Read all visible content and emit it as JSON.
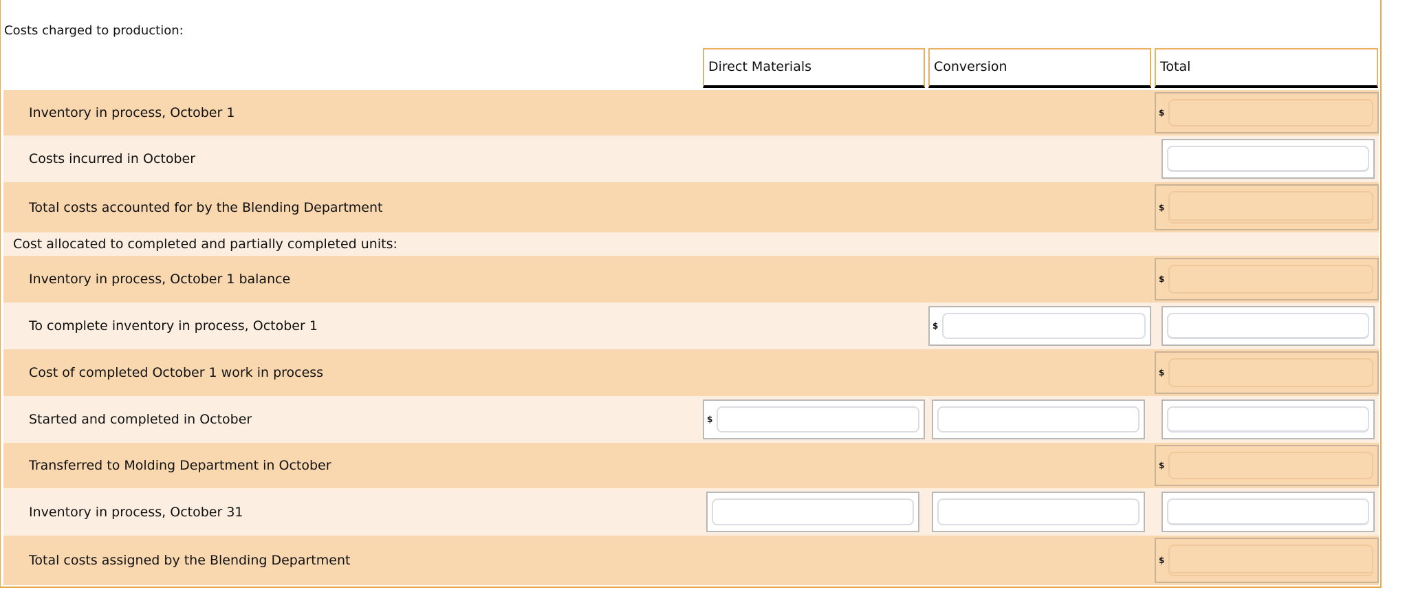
{
  "title": "Costs charged to production:",
  "headers": {
    "dm": "Direct Materials",
    "conv": "Conversion",
    "total": "Total"
  },
  "currency": "$",
  "rows": [
    {
      "label": "Inventory in process, October 1"
    },
    {
      "label": "Costs incurred in October"
    },
    {
      "label": "Total costs accounted for by the Blending Department"
    },
    {
      "label": "Cost allocated to completed and partially completed units:"
    },
    {
      "label": "Inventory in process, October 1 balance"
    },
    {
      "label": "To complete inventory in process, October 1"
    },
    {
      "label": "Cost of completed October 1 work in process"
    },
    {
      "label": "Started and completed in October"
    },
    {
      "label": "Transferred to Molding Department in October"
    },
    {
      "label": "Inventory in process, October 31"
    },
    {
      "label": "Total costs assigned by the Blending Department"
    }
  ]
}
